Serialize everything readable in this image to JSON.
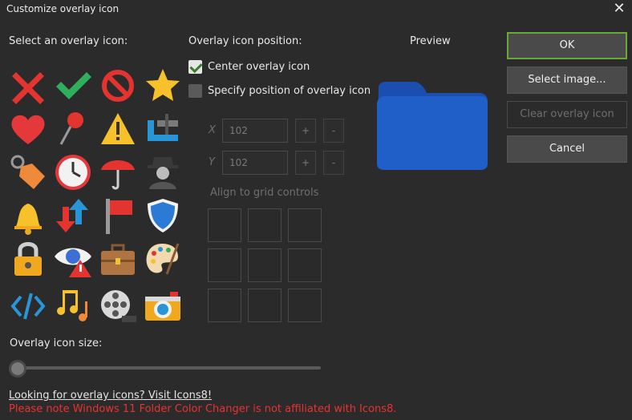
{
  "window": {
    "title": "Customize overlay icon",
    "close_glyph": "✕"
  },
  "icons_section": {
    "label": "Select an overlay icon:",
    "icons": [
      "cross-icon",
      "checkmark-icon",
      "prohibited-icon",
      "star-icon",
      "heart-icon",
      "pushpin-icon",
      "warning-icon",
      "clamp-icon",
      "price-tag-icon",
      "clock-icon",
      "umbrella-icon",
      "spy-icon",
      "bell-icon",
      "up-down-arrows-icon",
      "flag-icon",
      "shield-icon",
      "padlock-icon",
      "eye-warning-icon",
      "briefcase-icon",
      "palette-icon",
      "code-icon",
      "music-notes-icon",
      "film-reel-icon",
      "camera-icon"
    ]
  },
  "position": {
    "label": "Overlay icon position:",
    "center_label": "Center overlay icon",
    "specify_label": "Specify position of overlay icon",
    "center_checked": true,
    "x_label": "X",
    "y_label": "Y",
    "x_value": "102",
    "y_value": "102",
    "plus": "+",
    "minus": "-",
    "align_label": "Align to grid controls"
  },
  "preview": {
    "label": "Preview",
    "folder_color": "#1f5fc7"
  },
  "buttons": {
    "ok": "OK",
    "select_image": "Select image...",
    "clear": "Clear overlay icon",
    "cancel": "Cancel"
  },
  "size": {
    "label": "Overlay icon size:",
    "value_fraction": 0
  },
  "footer": {
    "link": "Looking for overlay icons? Visit Icons8!",
    "note": "Please note Windows 11 Folder Color Changer is not affiliated with Icons8."
  },
  "colors": {
    "accent_green": "#6aa83a",
    "note_red": "#e8322f",
    "background": "#2b2b2b"
  }
}
